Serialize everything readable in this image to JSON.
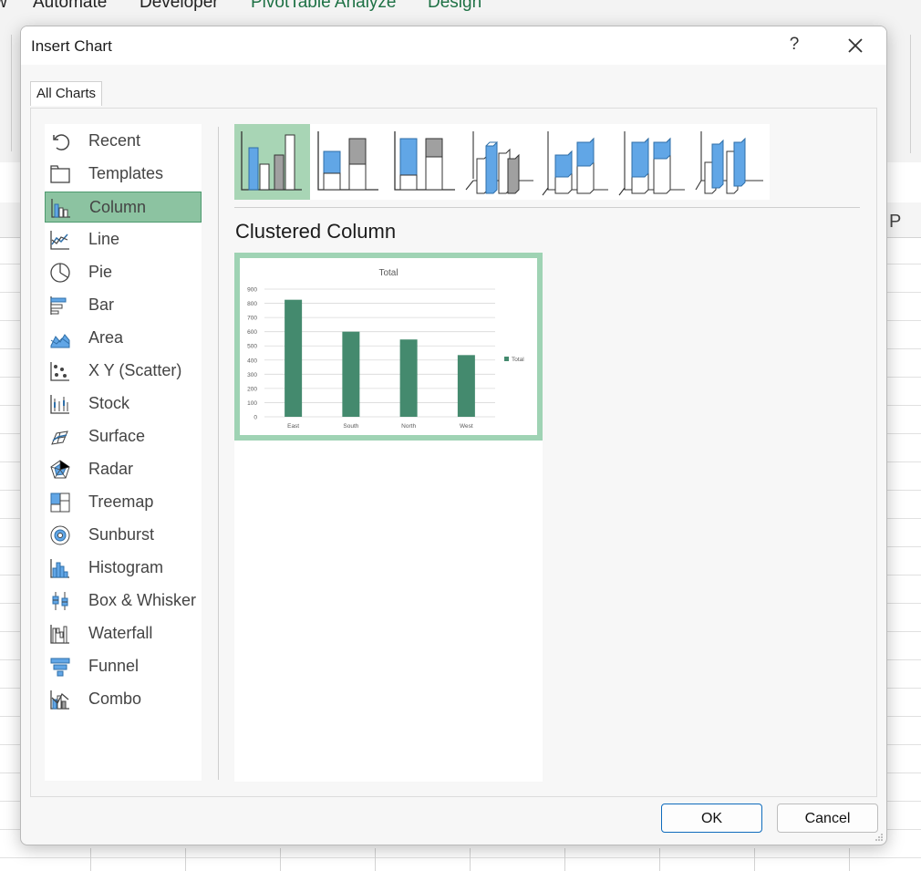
{
  "ribbon": {
    "tabs": [
      {
        "label": "w"
      },
      {
        "label": "Automate"
      },
      {
        "label": "Developer"
      },
      {
        "label": "PivotTable Analyze"
      },
      {
        "label": "Design"
      }
    ]
  },
  "sheet": {
    "column_label": "P"
  },
  "dialog": {
    "title": "Insert Chart",
    "help_label": "?",
    "tab_label": "All Charts",
    "categories": [
      {
        "label": "Recent",
        "icon": "recent-icon"
      },
      {
        "label": "Templates",
        "icon": "templates-icon"
      },
      {
        "label": "Column",
        "icon": "column-chart-icon"
      },
      {
        "label": "Line",
        "icon": "line-chart-icon"
      },
      {
        "label": "Pie",
        "icon": "pie-chart-icon"
      },
      {
        "label": "Bar",
        "icon": "bar-chart-icon"
      },
      {
        "label": "Area",
        "icon": "area-chart-icon"
      },
      {
        "label": "X Y (Scatter)",
        "icon": "scatter-chart-icon"
      },
      {
        "label": "Stock",
        "icon": "stock-chart-icon"
      },
      {
        "label": "Surface",
        "icon": "surface-chart-icon"
      },
      {
        "label": "Radar",
        "icon": "radar-chart-icon"
      },
      {
        "label": "Treemap",
        "icon": "treemap-chart-icon"
      },
      {
        "label": "Sunburst",
        "icon": "sunburst-chart-icon"
      },
      {
        "label": "Histogram",
        "icon": "histogram-chart-icon"
      },
      {
        "label": "Box & Whisker",
        "icon": "box-whisker-chart-icon"
      },
      {
        "label": "Waterfall",
        "icon": "waterfall-chart-icon"
      },
      {
        "label": "Funnel",
        "icon": "funnel-chart-icon"
      },
      {
        "label": "Combo",
        "icon": "combo-chart-icon"
      }
    ],
    "selected_category": "Column",
    "subtypes": [
      {
        "icon": "clustered-column-icon",
        "selected": true
      },
      {
        "icon": "stacked-column-icon",
        "selected": false
      },
      {
        "icon": "100-stacked-column-icon",
        "selected": false
      },
      {
        "icon": "3d-clustered-column-icon",
        "selected": false
      },
      {
        "icon": "3d-stacked-column-icon",
        "selected": false
      },
      {
        "icon": "3d-100-stacked-column-icon",
        "selected": false
      },
      {
        "icon": "3d-column-icon",
        "selected": false
      }
    ],
    "chart_type_title": "Clustered Column",
    "ok_label": "OK",
    "cancel_label": "Cancel",
    "accent_color": "#8cc3a1",
    "bar_color": "#448a6e"
  },
  "chart_data": {
    "type": "bar",
    "title": "Total",
    "categories": [
      "East",
      "South",
      "North",
      "West"
    ],
    "series": [
      {
        "name": "Total",
        "values": [
          825,
          600,
          545,
          435
        ]
      }
    ],
    "ylim": [
      0,
      900
    ],
    "yticks": [
      "0",
      "100",
      "200",
      "300",
      "400",
      "500",
      "600",
      "700",
      "800",
      "900"
    ],
    "grid": true,
    "legend": "right",
    "color": "#448a6e"
  }
}
